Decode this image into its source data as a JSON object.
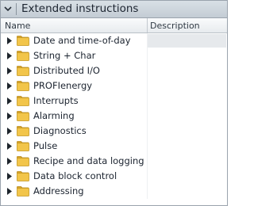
{
  "panel": {
    "title": "Extended instructions"
  },
  "table": {
    "columns": {
      "name": "Name",
      "description": "Description"
    },
    "rows": [
      {
        "label": "Date and time-of-day",
        "icon": "folder-icon",
        "selected": true
      },
      {
        "label": "String + Char",
        "icon": "folder-icon"
      },
      {
        "label": "Distributed I/O",
        "icon": "folder-icon"
      },
      {
        "label": "PROFIenergy",
        "icon": "folder-icon"
      },
      {
        "label": "Interrupts",
        "icon": "folder-icon"
      },
      {
        "label": "Alarming",
        "icon": "folder-icon"
      },
      {
        "label": "Diagnostics",
        "icon": "folder-icon"
      },
      {
        "label": "Pulse",
        "icon": "folder-icon"
      },
      {
        "label": "Recipe and data logging",
        "icon": "folder-icon"
      },
      {
        "label": "Data block control",
        "icon": "folder-icon"
      },
      {
        "label": "Addressing",
        "icon": "folder-icon"
      }
    ]
  },
  "colors": {
    "folder": "#f2c54a",
    "folder_dark": "#d9a52a",
    "title_bar": "#c9d1d8",
    "selected_description": "#e6e9ec"
  }
}
